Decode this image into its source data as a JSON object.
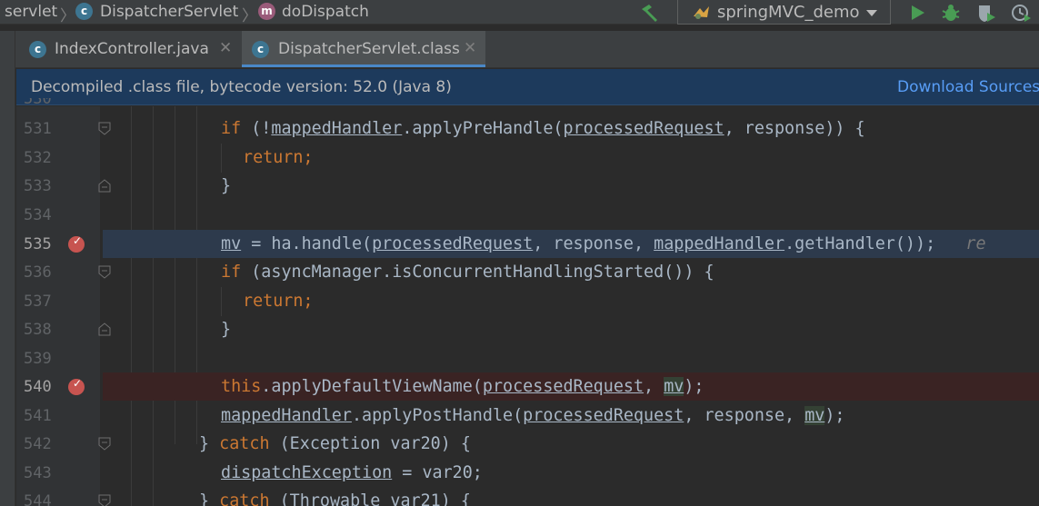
{
  "navbar": {
    "breadcrumbs": [
      "servlet",
      "DispatcherServlet",
      "doDispatch"
    ],
    "run_config": "springMVC_demo",
    "build_icon": "hammer-icon",
    "run_icon": "play-icon",
    "debug_icon": "bug-icon",
    "coverage_icon": "coverage-icon",
    "profile_icon": "profiler-icon"
  },
  "tabs": [
    {
      "label": "IndexController.java",
      "icon": "class-c-icon",
      "active": false
    },
    {
      "label": "DispatcherServlet.class",
      "icon": "class-c-lock-icon",
      "active": true
    }
  ],
  "banner": {
    "text": "Decompiled .class file, bytecode version: 52.0 (Java 8)",
    "link": "Download Sources"
  },
  "editor": {
    "lines": [
      {
        "no": "531",
        "marker": "",
        "fold": "start"
      },
      {
        "no": "532",
        "marker": "",
        "fold": ""
      },
      {
        "no": "533",
        "marker": "",
        "fold": "end"
      },
      {
        "no": "534",
        "marker": "",
        "fold": ""
      },
      {
        "no": "535",
        "marker": "breakpoint",
        "fold": ""
      },
      {
        "no": "536",
        "marker": "",
        "fold": "start"
      },
      {
        "no": "537",
        "marker": "",
        "fold": ""
      },
      {
        "no": "538",
        "marker": "",
        "fold": "end"
      },
      {
        "no": "539",
        "marker": "",
        "fold": ""
      },
      {
        "no": "540",
        "marker": "breakpoint",
        "fold": ""
      },
      {
        "no": "541",
        "marker": "",
        "fold": ""
      },
      {
        "no": "542",
        "marker": "",
        "fold": "start"
      },
      {
        "no": "543",
        "marker": "",
        "fold": ""
      },
      {
        "no": "544",
        "marker": "",
        "fold": "start"
      }
    ],
    "code": {
      "l531_kw": "if",
      "l531_a": " (!",
      "l531_field": "mappedHandler",
      "l531_b": ".applyPreHandle(",
      "l531_var": "processedRequest",
      "l531_c": ", response)) {",
      "l532": "return;",
      "l533": "}",
      "l535_mv": "mv",
      "l535_a": " = ha.handle(",
      "l535_var": "processedRequest",
      "l535_b": ", response, ",
      "l535_field": "mappedHandler",
      "l535_c": ".getHandler());",
      "l535_hint": "re",
      "l536_kw": "if",
      "l536_a": " (asyncManager.isConcurrentHandlingStarted()) {",
      "l537": "return;",
      "l538": "}",
      "l540_kw": "this",
      "l540_a": ".applyDefaultViewName(",
      "l540_var": "processedRequest",
      "l540_b": ", ",
      "l540_mv": "mv",
      "l540_c": ");",
      "l541_field": "mappedHandler",
      "l541_a": ".applyPostHandle(",
      "l541_var": "processedRequest",
      "l541_b": ", response, ",
      "l541_mv": "mv",
      "l541_c": ");",
      "l542_a": "} ",
      "l542_kw": "catch",
      "l542_b": " (Exception var20) {",
      "l543_var": "dispatchException",
      "l543_a": " = var20;",
      "l544_a": "} ",
      "l544_kw": "catch",
      "l544_b": " (Throwable var21) {"
    }
  },
  "colors": {
    "background": "#2b2b2b",
    "keyword": "#cc7832",
    "text": "#a9b7c6",
    "line_number": "#606366",
    "exec_line": "#2d3a4c",
    "breakpoint_line": "#3a2323",
    "breakpoint": "#c75450",
    "link": "#589df6",
    "run_green": "#499c54"
  }
}
